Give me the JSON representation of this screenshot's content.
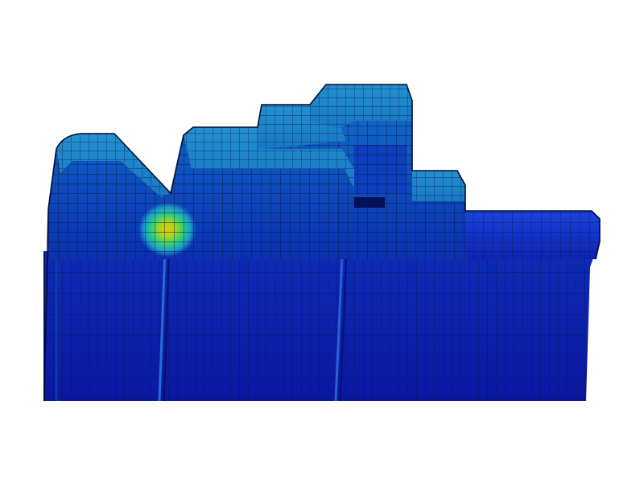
{
  "scene": {
    "subject": "fea-mesh-contour",
    "background_color": "#ffffff",
    "colors": {
      "hot_spot_core": "#e6c21a",
      "hot_spot_mid": "#55d02a",
      "hot_spot_outer": "#17c8a0",
      "ridge_cap": "#1b86c8",
      "upper_body": "#0f5cc6",
      "base": "#0b1aa8",
      "base_dark": "#07138a",
      "mesh_line": "#02103a",
      "right_slab": "#1a2fd0",
      "right_slab_top": "#1b3ee0"
    }
  }
}
